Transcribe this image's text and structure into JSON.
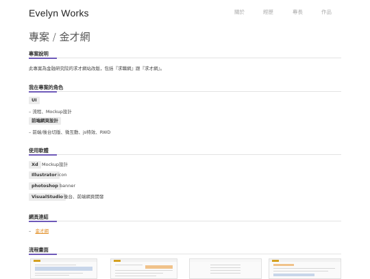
{
  "site": {
    "brand": "Evelyn Works"
  },
  "nav": {
    "items": [
      "關於",
      "經歷",
      "專長",
      "作品"
    ]
  },
  "page": {
    "title": "專案 / 金才網"
  },
  "sections": {
    "description": {
      "title": "專案說明",
      "text": "此專案為金融研究院的求才網站改版，包括『求職網』跟『求才網』。"
    },
    "role": {
      "title": "我在專案的角色",
      "items": [
        {
          "tag": "UI",
          "detail": "–  流程、Mockup設計"
        },
        {
          "tag": "前端網頁設計",
          "detail": "–  前端/後台切版、微互動、js特效、RWD"
        }
      ]
    },
    "software": {
      "title": "使用軟體",
      "items": [
        {
          "tag": "Xd",
          "detail": "Mockup設計"
        },
        {
          "tag": "Illustrator",
          "detail": "icon"
        },
        {
          "tag": "photoshop",
          "detail": "banner"
        },
        {
          "tag": "VisualStudio",
          "detail": "後台、前端網頁開發"
        }
      ]
    },
    "links": {
      "title": "網頁連結",
      "prefix": "–",
      "link_text": "金才網"
    },
    "flow": {
      "title": "流程畫面"
    }
  },
  "colors": {
    "accent": "#6d58b8",
    "link": "#e08a1e",
    "tag_bg": "#ececec"
  }
}
